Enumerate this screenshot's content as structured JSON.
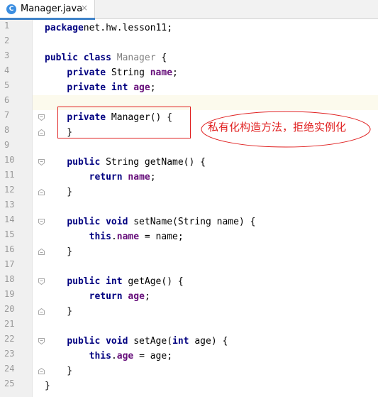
{
  "tab": {
    "icon": "C",
    "label": "Manager.java",
    "close": "×"
  },
  "annotation": "私有化构造方法，拒绝实例化",
  "colors": {
    "keyword": "#000080",
    "field": "#660e7a",
    "highlight": "#e02020",
    "current_line": "#fcfaed"
  },
  "lines": [
    {
      "n": "1",
      "parts": [
        [
          "kw",
          "package"
        ],
        [
          "",
          "net.hw.lesson11;"
        ]
      ]
    },
    {
      "n": "2",
      "parts": []
    },
    {
      "n": "3",
      "parts": [
        [
          "kw",
          "public class"
        ],
        [
          "",
          " "
        ],
        [
          "gray",
          "Manager"
        ],
        [
          "",
          " {"
        ]
      ]
    },
    {
      "n": "4",
      "parts": [
        [
          "",
          "    "
        ],
        [
          "kw",
          "private"
        ],
        [
          "",
          " String "
        ],
        [
          "fld",
          "name"
        ],
        [
          "",
          ";"
        ]
      ]
    },
    {
      "n": "5",
      "parts": [
        [
          "",
          "    "
        ],
        [
          "kw",
          "private int"
        ],
        [
          "",
          " "
        ],
        [
          "fld",
          "age"
        ],
        [
          "",
          ";"
        ]
      ]
    },
    {
      "n": "6",
      "parts": []
    },
    {
      "n": "7",
      "parts": [
        [
          "",
          "    "
        ],
        [
          "kw",
          "private"
        ],
        [
          "",
          " Manager() {"
        ]
      ]
    },
    {
      "n": "8",
      "parts": [
        [
          "",
          "    }"
        ]
      ]
    },
    {
      "n": "9",
      "parts": []
    },
    {
      "n": "10",
      "parts": [
        [
          "",
          "    "
        ],
        [
          "kw",
          "public"
        ],
        [
          "",
          " String getName() {"
        ]
      ]
    },
    {
      "n": "11",
      "parts": [
        [
          "",
          "        "
        ],
        [
          "kw",
          "return"
        ],
        [
          "",
          " "
        ],
        [
          "fld",
          "name"
        ],
        [
          "",
          ";"
        ]
      ]
    },
    {
      "n": "12",
      "parts": [
        [
          "",
          "    }"
        ]
      ]
    },
    {
      "n": "13",
      "parts": []
    },
    {
      "n": "14",
      "parts": [
        [
          "",
          "    "
        ],
        [
          "kw",
          "public void"
        ],
        [
          "",
          " setName(String name) {"
        ]
      ]
    },
    {
      "n": "15",
      "parts": [
        [
          "",
          "        "
        ],
        [
          "kw",
          "this"
        ],
        [
          "",
          "."
        ],
        [
          "fld",
          "name"
        ],
        [
          "",
          " = name;"
        ]
      ]
    },
    {
      "n": "16",
      "parts": [
        [
          "",
          "    }"
        ]
      ]
    },
    {
      "n": "17",
      "parts": []
    },
    {
      "n": "18",
      "parts": [
        [
          "",
          "    "
        ],
        [
          "kw",
          "public int"
        ],
        [
          "",
          " getAge() {"
        ]
      ]
    },
    {
      "n": "19",
      "parts": [
        [
          "",
          "        "
        ],
        [
          "kw",
          "return"
        ],
        [
          "",
          " "
        ],
        [
          "fld",
          "age"
        ],
        [
          "",
          ";"
        ]
      ]
    },
    {
      "n": "20",
      "parts": [
        [
          "",
          "    }"
        ]
      ]
    },
    {
      "n": "21",
      "parts": []
    },
    {
      "n": "22",
      "parts": [
        [
          "",
          "    "
        ],
        [
          "kw",
          "public void"
        ],
        [
          "",
          " setAge("
        ],
        [
          "kw",
          "int"
        ],
        [
          "",
          " age) {"
        ]
      ]
    },
    {
      "n": "23",
      "parts": [
        [
          "",
          "        "
        ],
        [
          "kw",
          "this"
        ],
        [
          "",
          "."
        ],
        [
          "fld",
          "age"
        ],
        [
          "",
          " = age;"
        ]
      ]
    },
    {
      "n": "24",
      "parts": [
        [
          "",
          "    }"
        ]
      ]
    },
    {
      "n": "25",
      "parts": [
        [
          "",
          "}"
        ]
      ]
    }
  ]
}
